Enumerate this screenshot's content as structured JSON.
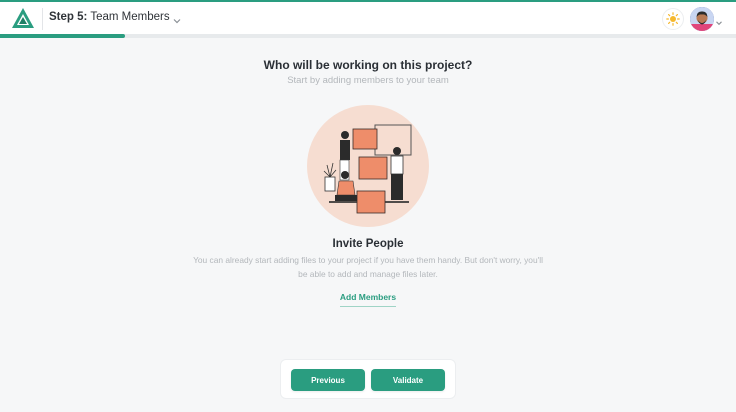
{
  "header": {
    "step_prefix": "Step 5:",
    "step_name": "Team Members",
    "progress_fraction": 0.17
  },
  "colors": {
    "accent": "#2a9d80",
    "illustration_bg": "#f6ddd1",
    "box_orange": "#ee8d6a"
  },
  "icons": {
    "logo": "triangle-logo-icon",
    "step_menu": "chevron-down-icon",
    "theme": "sun-icon",
    "user_menu": "chevron-down-icon"
  },
  "main": {
    "heading": "Who will be working on this project?",
    "subheading": "Start by adding members to your team",
    "invite_title": "Invite People",
    "invite_description": "You can already start adding files to your project if you have them handy. But don't worry, you'll be able to add and manage files later.",
    "add_members_label": "Add Members"
  },
  "footer": {
    "previous_label": "Previous",
    "validate_label": "Validate"
  }
}
